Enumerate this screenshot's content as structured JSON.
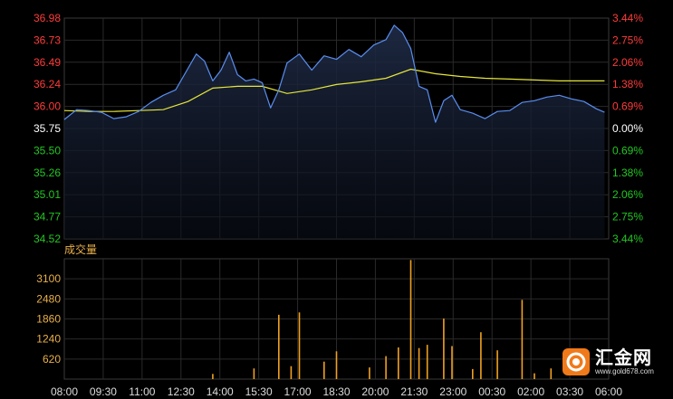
{
  "chart_data": {
    "type": "line",
    "price_axis": {
      "left_ticks": [
        "36.98",
        "36.73",
        "36.49",
        "36.24",
        "36.00",
        "35.75",
        "35.50",
        "35.26",
        "35.01",
        "34.77",
        "34.52"
      ],
      "right_ticks": [
        "3.44%",
        "2.75%",
        "2.06%",
        "1.38%",
        "0.69%",
        "0.00%",
        "0.69%",
        "1.38%",
        "2.06%",
        "2.75%",
        "3.44%"
      ],
      "ylim": [
        34.52,
        36.98
      ],
      "reference_price": 35.75,
      "up_color": "#ff3b3b",
      "down_color": "#22c722",
      "flat_color": "#ffffff"
    },
    "volume_axis": {
      "label": "成交量",
      "ticks": [
        "3100",
        "2480",
        "1860",
        "1240",
        "620"
      ],
      "tick_values": [
        3100,
        2480,
        1860,
        1240,
        620
      ],
      "ylim": [
        0,
        3720
      ]
    },
    "x_axis": {
      "ticks": [
        "08:00",
        "09:30",
        "11:00",
        "12:30",
        "14:00",
        "15:30",
        "17:00",
        "18:30",
        "20:00",
        "21:30",
        "23:00",
        "00:30",
        "02:00",
        "03:30",
        "06:00"
      ]
    },
    "series": [
      {
        "name": "",
        "color": "#5a8ef0",
        "x": [
          "08:00",
          "08:30",
          "09:00",
          "09:30",
          "10:00",
          "10:30",
          "11:00",
          "11:30",
          "12:00",
          "12:30",
          "13:00",
          "13:20",
          "13:40",
          "14:00",
          "14:20",
          "14:40",
          "15:00",
          "15:20",
          "15:40",
          "16:00",
          "16:20",
          "16:40",
          "17:00",
          "17:30",
          "18:00",
          "18:30",
          "19:00",
          "19:30",
          "20:00",
          "20:30",
          "21:00",
          "21:20",
          "21:40",
          "22:00",
          "22:20",
          "22:40",
          "23:00",
          "23:20",
          "23:40",
          "00:00",
          "00:30",
          "01:00",
          "01:30",
          "02:00",
          "02:30",
          "03:00",
          "03:30",
          "04:00",
          "04:30",
          "05:00",
          "05:30",
          "05:50"
        ],
        "values": [
          35.85,
          35.96,
          35.95,
          35.93,
          35.86,
          35.88,
          35.94,
          36.04,
          36.12,
          36.18,
          36.42,
          36.58,
          36.5,
          36.28,
          36.4,
          36.6,
          36.35,
          36.28,
          36.3,
          36.26,
          35.98,
          36.18,
          36.48,
          36.58,
          36.4,
          36.56,
          36.52,
          36.63,
          36.55,
          36.68,
          36.74,
          36.9,
          36.82,
          36.64,
          36.22,
          36.18,
          35.82,
          36.06,
          36.12,
          35.96,
          35.92,
          35.86,
          35.94,
          35.95,
          36.04,
          36.06,
          36.1,
          36.12,
          36.08,
          36.05,
          35.97,
          35.93
        ]
      },
      {
        "name": "",
        "color": "#e6e63a",
        "x": [
          "08:00",
          "09:00",
          "10:00",
          "11:00",
          "12:00",
          "13:00",
          "14:00",
          "15:00",
          "16:00",
          "17:00",
          "18:00",
          "19:00",
          "20:00",
          "21:00",
          "22:00",
          "23:00",
          "00:00",
          "01:00",
          "02:00",
          "03:00",
          "04:00",
          "05:00",
          "05:50"
        ],
        "values": [
          35.95,
          35.94,
          35.94,
          35.95,
          35.96,
          36.05,
          36.2,
          36.22,
          36.22,
          36.14,
          36.18,
          36.24,
          36.27,
          36.31,
          36.41,
          36.36,
          36.33,
          36.31,
          36.3,
          36.29,
          36.28,
          36.28,
          36.28
        ]
      }
    ],
    "volume_series": {
      "name": "",
      "color": "#f0a020",
      "peaks": [
        {
          "x": "14:00",
          "value": 160
        },
        {
          "x": "15:40",
          "value": 330
        },
        {
          "x": "16:40",
          "value": 1990
        },
        {
          "x": "17:10",
          "value": 400
        },
        {
          "x": "17:30",
          "value": 2060
        },
        {
          "x": "18:30",
          "value": 540
        },
        {
          "x": "19:00",
          "value": 860
        },
        {
          "x": "20:20",
          "value": 360
        },
        {
          "x": "21:00",
          "value": 710
        },
        {
          "x": "21:30",
          "value": 980
        },
        {
          "x": "22:00",
          "value": 3680
        },
        {
          "x": "22:20",
          "value": 960
        },
        {
          "x": "22:40",
          "value": 1060
        },
        {
          "x": "23:20",
          "value": 1870
        },
        {
          "x": "23:40",
          "value": 1020
        },
        {
          "x": "00:30",
          "value": 310
        },
        {
          "x": "00:50",
          "value": 1450
        },
        {
          "x": "01:30",
          "value": 890
        },
        {
          "x": "02:30",
          "value": 2450
        },
        {
          "x": "03:00",
          "value": 180
        },
        {
          "x": "03:40",
          "value": 330
        }
      ]
    }
  },
  "watermark": {
    "name": "汇金网",
    "url": "www.gold678.com"
  }
}
